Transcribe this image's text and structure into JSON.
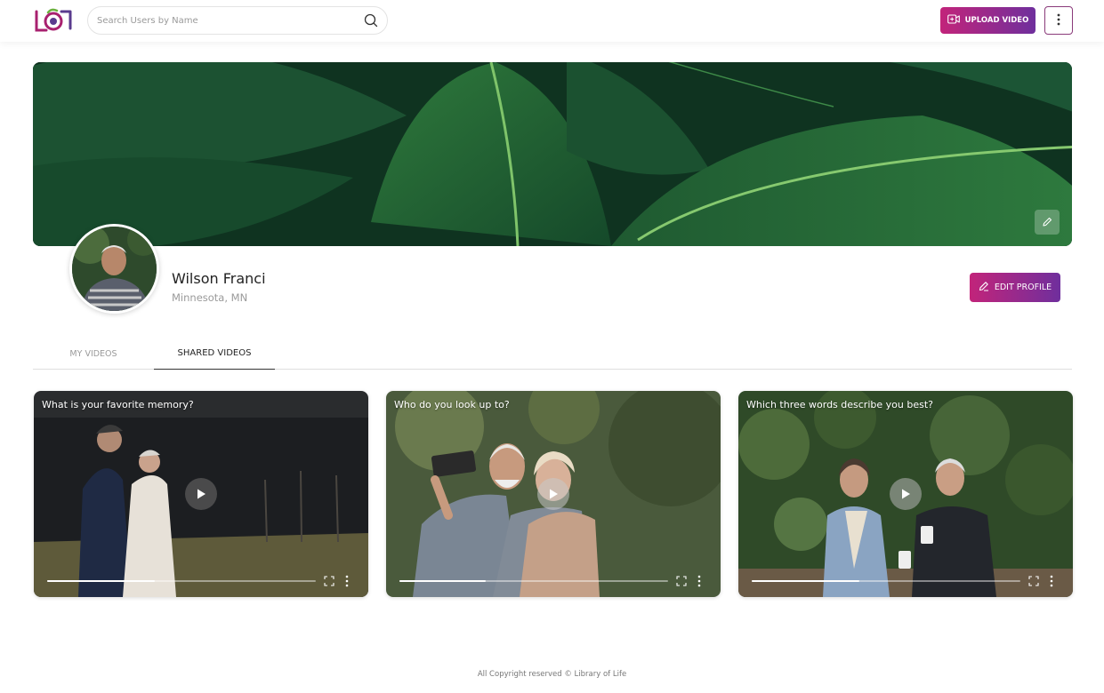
{
  "header": {
    "search_placeholder": "Search Users by Name",
    "upload_label": "UPLOAD VIDEO"
  },
  "profile": {
    "name": "Wilson Franci",
    "location": "Minnesota, MN",
    "edit_label": "EDIT PROFILE"
  },
  "tabs": [
    {
      "label": "MY VIDEOS",
      "active": false
    },
    {
      "label": "SHARED VIDEOS",
      "active": true
    }
  ],
  "videos": [
    {
      "title": "What is your favorite memory?",
      "progress": 0.4
    },
    {
      "title": "Who do you look up to?",
      "progress": 0.32
    },
    {
      "title": "Which three words describe you best?",
      "progress": 0.4
    }
  ],
  "footer": {
    "copyright": "All Copyright reserved © Library of Life"
  },
  "colors": {
    "accent_start": "#c2247a",
    "accent_end": "#6f2f9d"
  },
  "icons": [
    "logo-icon",
    "search-icon",
    "video-camera-icon",
    "more-vertical-icon",
    "pencil-icon",
    "play-icon",
    "fullscreen-icon"
  ]
}
